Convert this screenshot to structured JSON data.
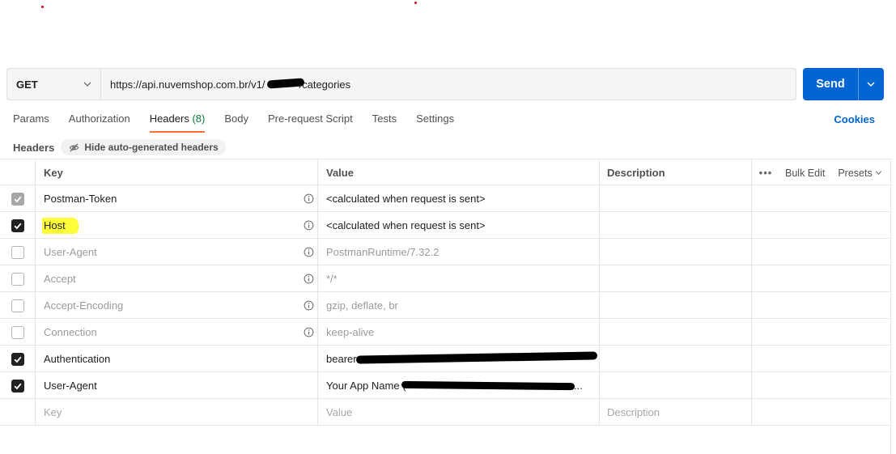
{
  "request": {
    "method": "GET",
    "url": "https://api.nuvemshop.com.br/v1/",
    "url_suffix": "/categories",
    "send_label": "Send"
  },
  "tabs": [
    {
      "label": "Params"
    },
    {
      "label": "Authorization"
    },
    {
      "label": "Headers",
      "count": "(8)",
      "active": true
    },
    {
      "label": "Body"
    },
    {
      "label": "Pre-request Script"
    },
    {
      "label": "Tests"
    },
    {
      "label": "Settings"
    }
  ],
  "cookies_label": "Cookies",
  "subheader": {
    "label": "Headers",
    "hide_button": "Hide auto-generated headers"
  },
  "table": {
    "columns": {
      "key": "Key",
      "value": "Value",
      "description": "Description"
    },
    "tools": {
      "more": "•••",
      "bulk_edit": "Bulk Edit",
      "presets": "Presets"
    },
    "rows": [
      {
        "key": "Postman-Token",
        "value": "<calculated when request is sent>",
        "checked": "disabled",
        "auto": true
      },
      {
        "key": "Host",
        "value": "<calculated when request is sent>",
        "checked": "on",
        "auto": true,
        "highlight": true
      },
      {
        "key": "User-Agent",
        "value": "PostmanRuntime/7.32.2",
        "checked": "off",
        "auto": true
      },
      {
        "key": "Accept",
        "value": "*/*",
        "checked": "off",
        "auto": true
      },
      {
        "key": "Accept-Encoding",
        "value": "gzip, deflate, br",
        "checked": "off",
        "auto": true
      },
      {
        "key": "Connection",
        "value": "keep-alive",
        "checked": "off",
        "auto": true
      },
      {
        "key": "Authentication",
        "value": "bearer",
        "checked": "on",
        "auto": false
      },
      {
        "key": "User-Agent",
        "value": "Your App Name (",
        "value_tail": "...",
        "checked": "on",
        "auto": false
      }
    ],
    "placeholders": {
      "key": "Key",
      "value": "Value",
      "description": "Description"
    }
  },
  "colors": {
    "accent": "#0265d2",
    "active_tab": "#ff6c37",
    "count": "#0a7c36",
    "highlight": "#fffc3a"
  }
}
